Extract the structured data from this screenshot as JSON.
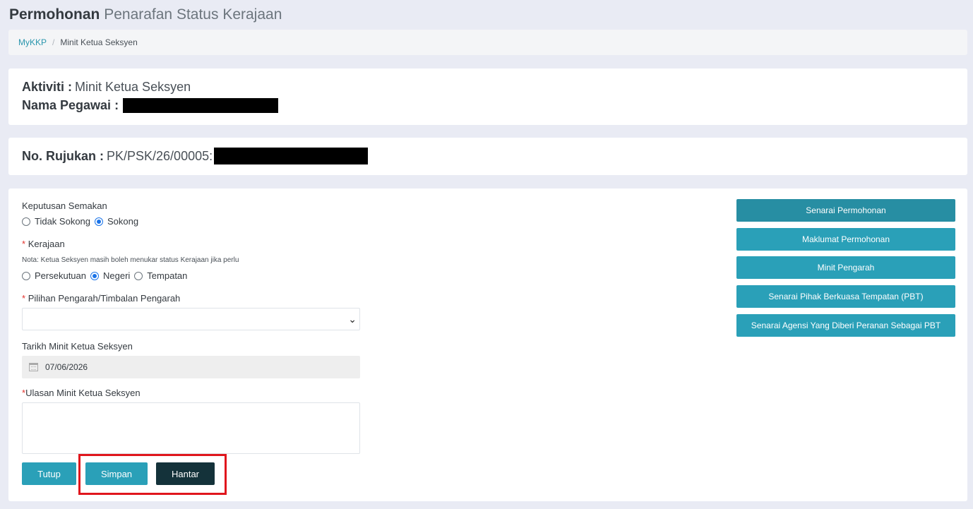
{
  "page": {
    "title_bold": "Permohonan",
    "title_light": "Penarafan Status Kerajaan"
  },
  "breadcrumb": {
    "home": "MyKKP",
    "separator": "/",
    "current": "Minit Ketua Seksyen"
  },
  "activity": {
    "aktiviti_label": "Aktiviti :",
    "aktiviti_value": "Minit Ketua Seksyen",
    "nama_label": "Nama Pegawai :"
  },
  "reference": {
    "label": "No. Rujukan :",
    "value": "PK/PSK/26/00005:"
  },
  "form": {
    "keputusan_label": "Keputusan Semakan",
    "keputusan_options": [
      "Tidak Sokong",
      "Sokong"
    ],
    "keputusan_selected": "Sokong",
    "required_mark": "*",
    "kerajaan_label": "Kerajaan",
    "kerajaan_note": "Nota: Ketua Seksyen masih boleh menukar status Kerajaan jika perlu",
    "kerajaan_options": [
      "Persekutuan",
      "Negeri",
      "Tempatan"
    ],
    "kerajaan_selected": "Negeri",
    "pengarah_label": "Pilihan Pengarah/Timbalan Pengarah",
    "pengarah_value": "",
    "tarikh_label": "Tarikh Minit Ketua Seksyen",
    "tarikh_value": "07/06/2026",
    "ulasan_label": "Ulasan Minit Ketua Seksyen",
    "ulasan_value": ""
  },
  "buttons": {
    "tutup": "Tutup",
    "simpan": "Simpan",
    "hantar": "Hantar"
  },
  "side_buttons": [
    "Senarai Permohonan",
    "Maklumat Permohonan",
    "Minit Pengarah",
    "Senarai Pihak Berkuasa Tempatan (PBT)",
    "Senarai Agensi Yang Diberi Peranan Sebagai PBT"
  ],
  "colors": {
    "accent": "#2aa0b8",
    "dark_button": "#14323a",
    "highlight": "#e0161d",
    "background": "#e9ebf4"
  }
}
